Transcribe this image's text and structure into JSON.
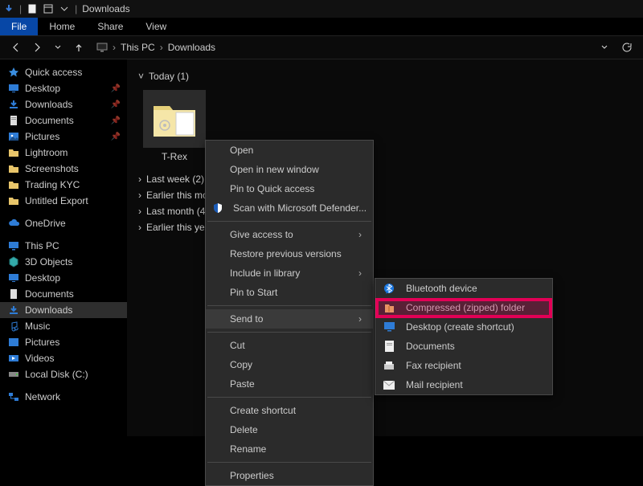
{
  "titlebar": {
    "app": "Downloads"
  },
  "ribbon": {
    "file": "File",
    "home": "Home",
    "share": "Share",
    "view": "View"
  },
  "address": {
    "root": "This PC",
    "folder": "Downloads"
  },
  "sidebar": {
    "quick": "Quick access",
    "quick_items": [
      {
        "label": "Desktop"
      },
      {
        "label": "Downloads"
      },
      {
        "label": "Documents"
      },
      {
        "label": "Pictures"
      },
      {
        "label": "Lightroom"
      },
      {
        "label": "Screenshots"
      },
      {
        "label": "Trading KYC"
      },
      {
        "label": "Untitled Export"
      }
    ],
    "onedrive": "OneDrive",
    "thispc": "This PC",
    "pc_items": [
      {
        "label": "3D Objects"
      },
      {
        "label": "Desktop"
      },
      {
        "label": "Documents"
      },
      {
        "label": "Downloads"
      },
      {
        "label": "Music"
      },
      {
        "label": "Pictures"
      },
      {
        "label": "Videos"
      },
      {
        "label": "Local Disk (C:)"
      }
    ],
    "network": "Network"
  },
  "content": {
    "groups": {
      "today": "Today (1)",
      "lastweek": "Last week (2)",
      "earliermonth": "Earlier this month",
      "lastmonth": "Last month (4)",
      "earlieryear": "Earlier this year"
    },
    "selected_item": "T-Rex"
  },
  "ctx": {
    "open": "Open",
    "opennew": "Open in new window",
    "pinquick": "Pin to Quick access",
    "scan": "Scan with Microsoft Defender...",
    "giveaccess": "Give access to",
    "restore": "Restore previous versions",
    "include": "Include in library",
    "pinstart": "Pin to Start",
    "sendto": "Send to",
    "cut": "Cut",
    "copy": "Copy",
    "paste": "Paste",
    "shortcut": "Create shortcut",
    "delete": "Delete",
    "rename": "Rename",
    "properties": "Properties"
  },
  "sendto": {
    "bluetooth": "Bluetooth device",
    "compressed": "Compressed (zipped) folder",
    "desktopshortcut": "Desktop (create shortcut)",
    "documents": "Documents",
    "fax": "Fax recipient",
    "mail": "Mail recipient"
  }
}
